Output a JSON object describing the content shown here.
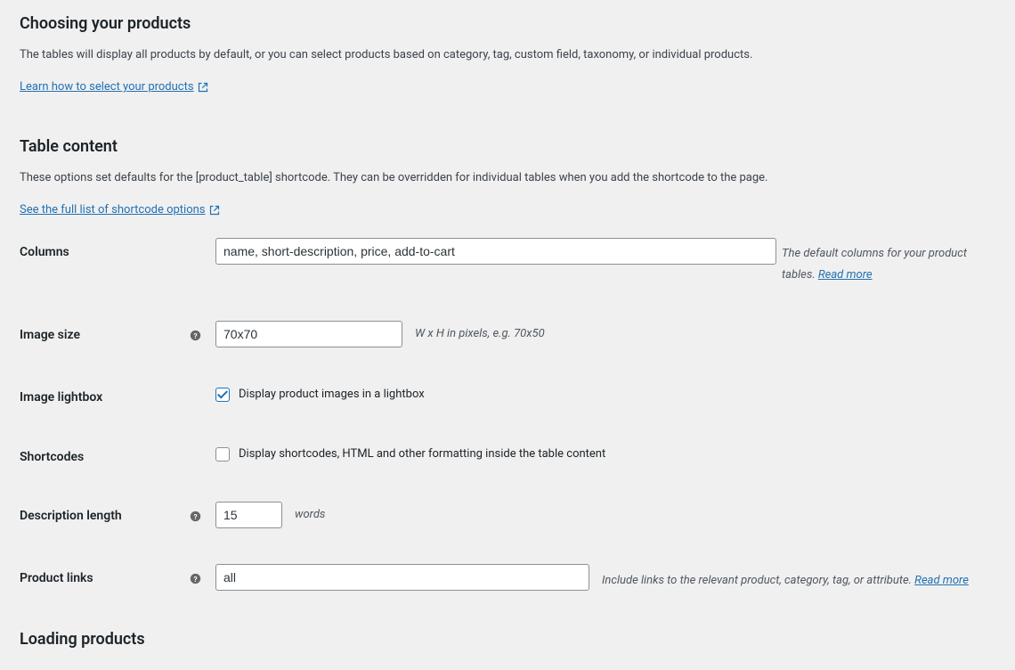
{
  "sections": {
    "choosing": {
      "title": "Choosing your products",
      "desc": "The tables will display all products by default, or you can select products based on category, tag, custom field, taxonomy, or individual products.",
      "link": "Learn how to select your products"
    },
    "content": {
      "title": "Table content",
      "desc": "These options set defaults for the [product_table] shortcode. They can be overridden for individual tables when you add the shortcode to the page.",
      "link": "See the full list of shortcode options"
    },
    "loading": {
      "title": "Loading products"
    }
  },
  "fields": {
    "columns": {
      "label": "Columns",
      "value": "name, short-description, price, add-to-cart",
      "desc_prefix": "The default columns for your product tables. ",
      "readmore": "Read more"
    },
    "image_size": {
      "label": "Image size",
      "value": "70x70",
      "desc": "W x H in pixels, e.g. 70x50"
    },
    "lightbox": {
      "label": "Image lightbox",
      "checkbox_label": "Display product images in a lightbox",
      "checked": true
    },
    "shortcodes": {
      "label": "Shortcodes",
      "checkbox_label": "Display shortcodes, HTML and other formatting inside the table content",
      "checked": false
    },
    "desc_length": {
      "label": "Description length",
      "value": "15",
      "desc": "words"
    },
    "product_links": {
      "label": "Product links",
      "value": "all",
      "desc_prefix": "Include links to the relevant product, category, tag, or attribute. ",
      "readmore": "Read more"
    }
  }
}
